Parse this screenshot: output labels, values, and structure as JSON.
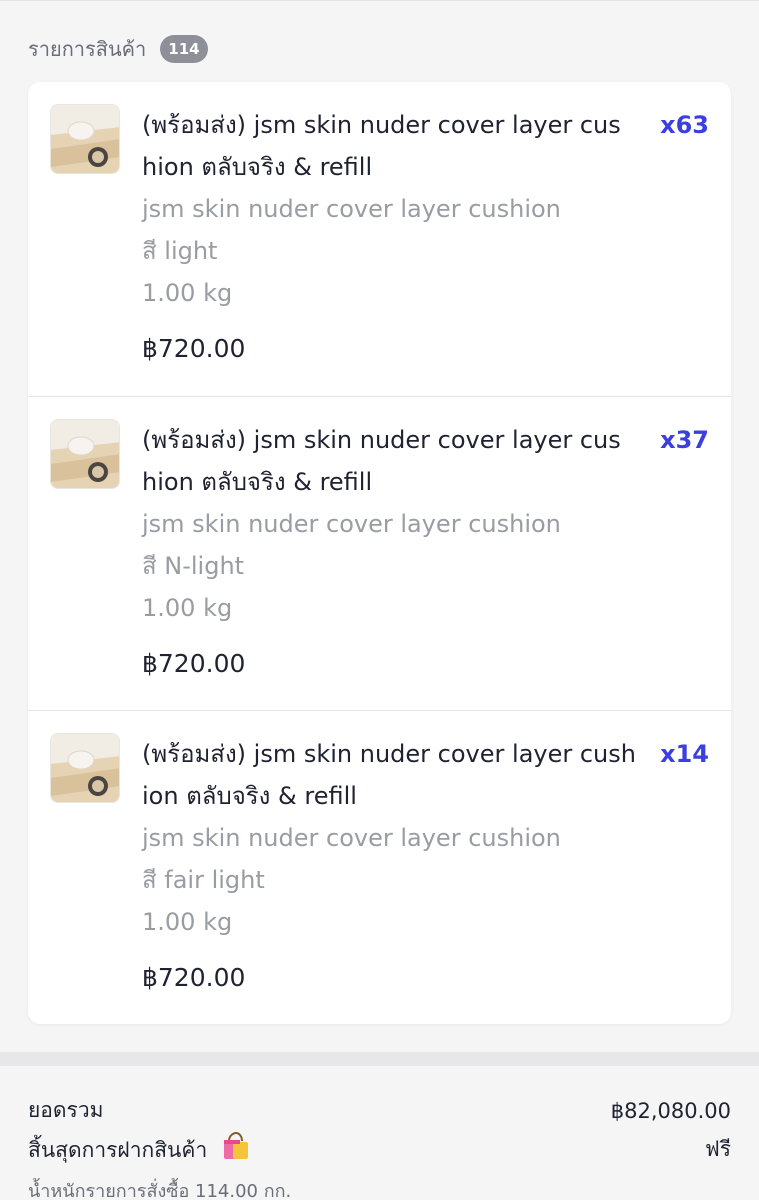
{
  "header": {
    "title": "รายการสินค้า",
    "item_count": "114"
  },
  "items": [
    {
      "title": "(พร้อมส่ง) jsm skin nuder cover layer cus hion ตลับจริง & refill",
      "quantity": "x63",
      "variant_name": "jsm skin nuder cover layer cushion",
      "color": "สี light",
      "weight": "1.00 kg",
      "price": "฿720.00"
    },
    {
      "title": "(พร้อมส่ง) jsm skin nuder cover layer cus hion ตลับจริง & refill",
      "quantity": "x37",
      "variant_name": "jsm skin nuder cover layer cushion",
      "color": "สี N-light",
      "weight": "1.00 kg",
      "price": "฿720.00"
    },
    {
      "title": "(พร้อมส่ง) jsm skin nuder cover layer cush ion ตลับจริง & refill",
      "quantity": "x14",
      "variant_name": "jsm skin nuder cover layer cushion",
      "color": "สี fair light",
      "weight": "1.00 kg",
      "price": "฿720.00"
    }
  ],
  "summary": {
    "total_label": "ยอดรวม",
    "total_value": "฿82,080.00",
    "shipping_label": "สิ้นสุดการฝากสินค้า",
    "shipping_icon": "shopping-bag-icon",
    "shipping_value": "ฟรี",
    "weight_note": "น้ำหนักรายการสั่งซื้อ 114.00 กก."
  },
  "colors": {
    "accent": "#3b3fe0",
    "badge": "#8d9099",
    "muted_text": "#9a9ca4"
  }
}
